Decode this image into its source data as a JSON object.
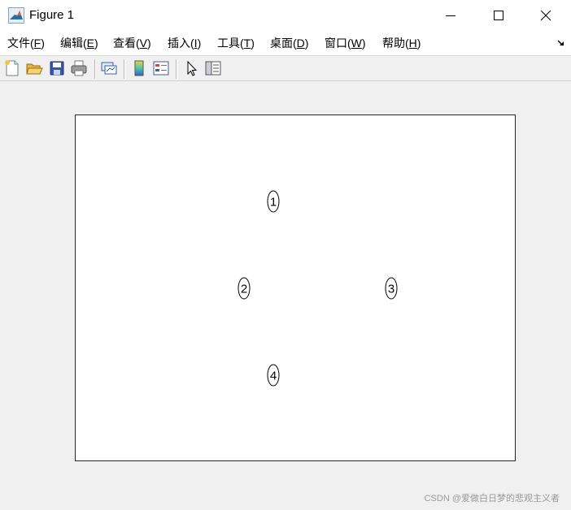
{
  "window": {
    "title": "Figure 1",
    "icon": "matlab-icon",
    "controls": [
      "minimize-icon",
      "maximize-icon",
      "close-icon"
    ]
  },
  "menu": {
    "items": [
      {
        "label": "文件(",
        "accel": "F",
        "end": ")"
      },
      {
        "label": "编辑(",
        "accel": "E",
        "end": ")"
      },
      {
        "label": "查看(",
        "accel": "V",
        "end": ")"
      },
      {
        "label": "插入(",
        "accel": "I",
        "end": ")"
      },
      {
        "label": "工具(",
        "accel": "T",
        "end": ")"
      },
      {
        "label": "桌面(",
        "accel": "D",
        "end": ")"
      },
      {
        "label": "窗口(",
        "accel": "W",
        "end": ")"
      },
      {
        "label": "帮助(",
        "accel": "H",
        "end": ")"
      }
    ],
    "overflow_icon": "dock-arrow-icon"
  },
  "toolbar": {
    "buttons": [
      "new-figure-icon",
      "open-file-icon",
      "save-icon",
      "print-icon",
      "link-plot-icon",
      "colorbar-icon",
      "legend-icon",
      "select-pointer-icon",
      "property-inspector-icon"
    ]
  },
  "graph": {
    "nodes": [
      {
        "label": "1"
      },
      {
        "label": "2"
      },
      {
        "label": "3"
      },
      {
        "label": "4"
      }
    ],
    "node_shape": "ellipse",
    "edges": []
  },
  "watermark": "CSDN @爱做白日梦的悲观主义者",
  "colors": {
    "titlebar_bg": "#ffffff",
    "figure_bg": "#f0f0f0",
    "axes_bg": "#ffffff",
    "axes_border": "#262626",
    "node_stroke": "#000000"
  }
}
